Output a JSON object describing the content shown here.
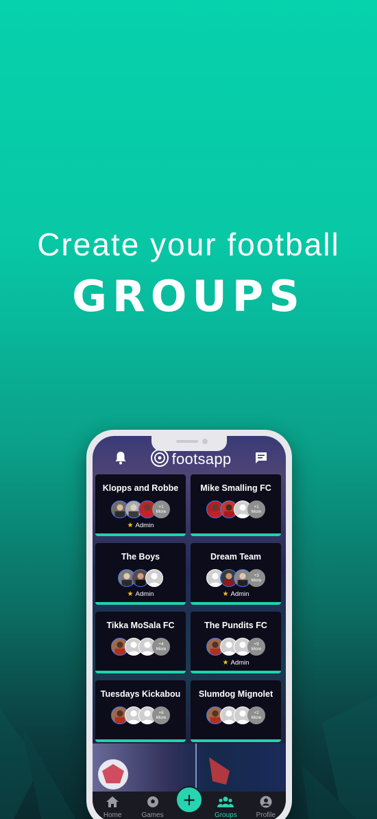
{
  "headline": {
    "line1": "Create your football",
    "line2": "GROUPS"
  },
  "app": {
    "logo_text": "footsapp",
    "icons": {
      "left": "bell-icon",
      "right": "chat-icon"
    }
  },
  "groups": [
    {
      "name": "Klopps and Robbe",
      "more": "+1",
      "more_label": "More",
      "admin": true
    },
    {
      "name": "Mike Smalling FC",
      "more": "+1",
      "more_label": "More",
      "admin": false
    },
    {
      "name": "The Boys",
      "more": "",
      "more_label": "",
      "admin": true
    },
    {
      "name": "Dream Team",
      "more": "+3",
      "more_label": "More",
      "admin": true
    },
    {
      "name": "Tikka MoSala FC",
      "more": "+4",
      "more_label": "More",
      "admin": false
    },
    {
      "name": "The Pundits FC",
      "more": "+9",
      "more_label": "More",
      "admin": true
    },
    {
      "name": "Tuesdays Kickabou",
      "more": "+6",
      "more_label": "More",
      "admin": false
    },
    {
      "name": "Slumdog Mignolet",
      "more": "+2",
      "more_label": "More",
      "admin": false
    }
  ],
  "admin_label": "Admin",
  "tabs": [
    {
      "label": "Home",
      "icon": "home-icon"
    },
    {
      "label": "Games",
      "icon": "soccer-ball-icon"
    },
    {
      "label": "",
      "icon": "plus-icon"
    },
    {
      "label": "Groups",
      "icon": "groups-icon",
      "active": true
    },
    {
      "label": "Profile",
      "icon": "profile-icon"
    }
  ],
  "fab_label": "+",
  "colors": {
    "accent": "#1ed3ad",
    "card_bg": "#0c0c1a",
    "star": "#f8c21a"
  }
}
